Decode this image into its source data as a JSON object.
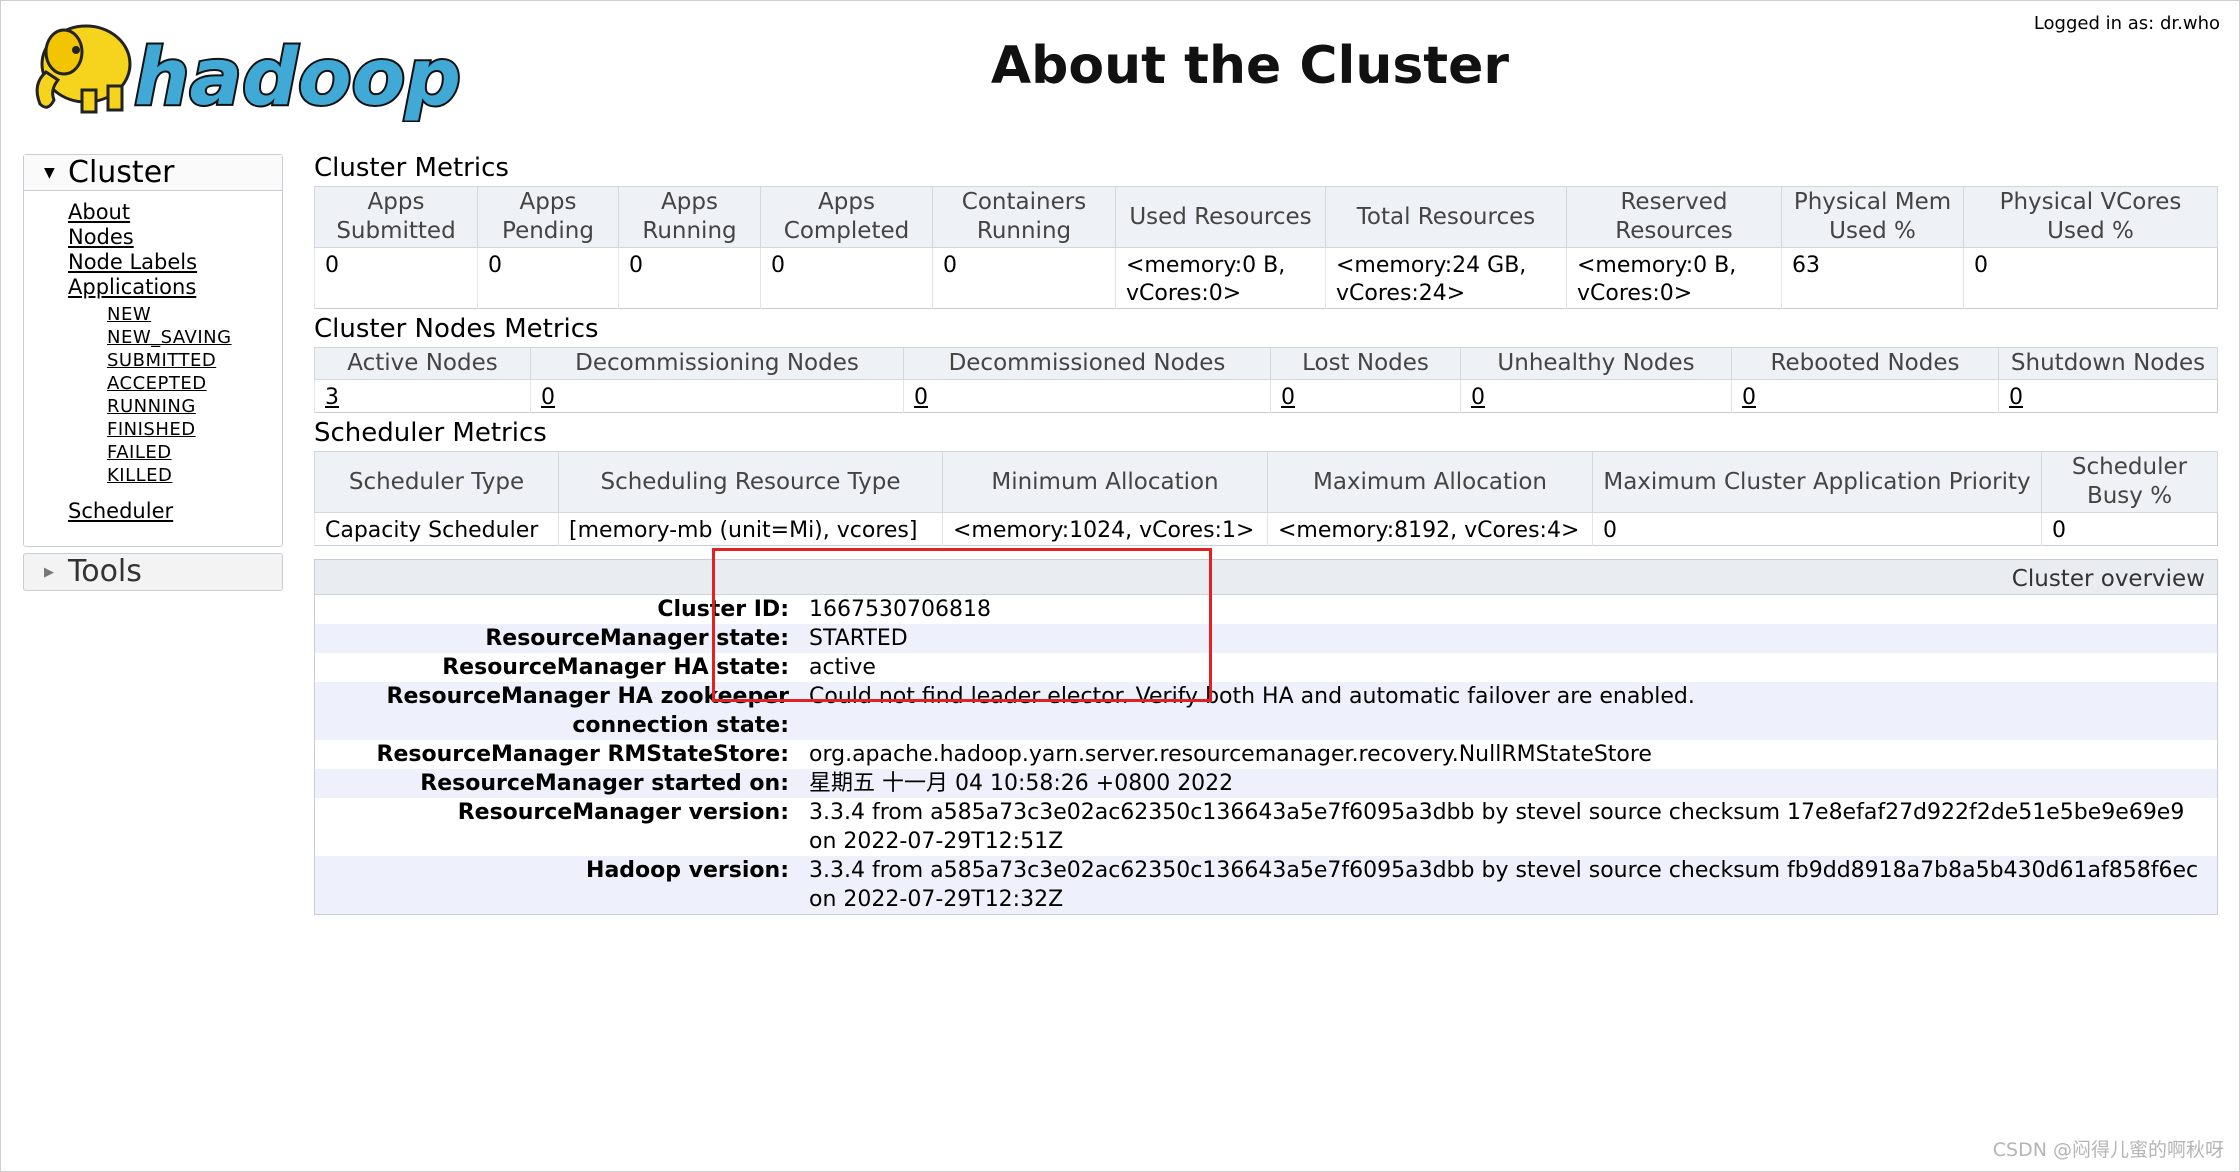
{
  "header": {
    "logo_text": "hadoop",
    "title": "About the Cluster",
    "logged_in": "Logged in as: dr.who"
  },
  "sidebar": {
    "cluster_label": "Cluster",
    "links": [
      "About",
      "Nodes",
      "Node Labels",
      "Applications"
    ],
    "app_states": [
      "NEW",
      "NEW_SAVING",
      "SUBMITTED",
      "ACCEPTED",
      "RUNNING",
      "FINISHED",
      "FAILED",
      "KILLED"
    ],
    "scheduler_label": "Scheduler",
    "tools_label": "Tools"
  },
  "cluster_metrics": {
    "title": "Cluster Metrics",
    "headers": [
      "Apps Submitted",
      "Apps Pending",
      "Apps Running",
      "Apps Completed",
      "Containers Running",
      "Used Resources",
      "Total Resources",
      "Reserved Resources",
      "Physical Mem Used %",
      "Physical VCores Used %"
    ],
    "values": [
      "0",
      "0",
      "0",
      "0",
      "0",
      "<memory:0 B, vCores:0>",
      "<memory:24 GB, vCores:24>",
      "<memory:0 B, vCores:0>",
      "63",
      "0"
    ]
  },
  "node_metrics": {
    "title": "Cluster Nodes Metrics",
    "headers": [
      "Active Nodes",
      "Decommissioning Nodes",
      "Decommissioned Nodes",
      "Lost Nodes",
      "Unhealthy Nodes",
      "Rebooted Nodes",
      "Shutdown Nodes"
    ],
    "values": [
      "3",
      "0",
      "0",
      "0",
      "0",
      "0",
      "0"
    ]
  },
  "scheduler_metrics": {
    "title": "Scheduler Metrics",
    "headers": [
      "Scheduler Type",
      "Scheduling Resource Type",
      "Minimum Allocation",
      "Maximum Allocation",
      "Maximum Cluster Application Priority",
      "Scheduler Busy %"
    ],
    "values": [
      "Capacity Scheduler",
      "[memory-mb (unit=Mi), vcores]",
      "<memory:1024, vCores:1>",
      "<memory:8192, vCores:4>",
      "0",
      "0"
    ]
  },
  "overview": {
    "title": "Cluster overview",
    "rows": [
      {
        "key": "Cluster ID:",
        "value": "1667530706818"
      },
      {
        "key": "ResourceManager state:",
        "value": "STARTED"
      },
      {
        "key": "ResourceManager HA state:",
        "value": "active"
      },
      {
        "key": "ResourceManager HA zookeeper connection state:",
        "value": "Could not find leader elector. Verify both HA and automatic failover are enabled."
      },
      {
        "key": "ResourceManager RMStateStore:",
        "value": "org.apache.hadoop.yarn.server.resourcemanager.recovery.NullRMStateStore"
      },
      {
        "key": "ResourceManager started on:",
        "value": "星期五 十一月 04 10:58:26 +0800 2022"
      },
      {
        "key": "ResourceManager version:",
        "value": "3.3.4 from a585a73c3e02ac62350c136643a5e7f6095a3dbb by stevel source checksum 17e8efaf27d922f2de51e5be9e69e9 on 2022-07-29T12:51Z"
      },
      {
        "key": "Hadoop version:",
        "value": "3.3.4 from a585a73c3e02ac62350c136643a5e7f6095a3dbb by stevel source checksum fb9dd8918a7b8a5b430d61af858f6ec on 2022-07-29T12:32Z"
      }
    ]
  },
  "watermark": "CSDN @闷得儿蜜的啊秋呀",
  "colors": {
    "highlight_box": "#e12222",
    "logo_yellow": "#f6d31c",
    "logo_blue": "#41a9d6"
  }
}
